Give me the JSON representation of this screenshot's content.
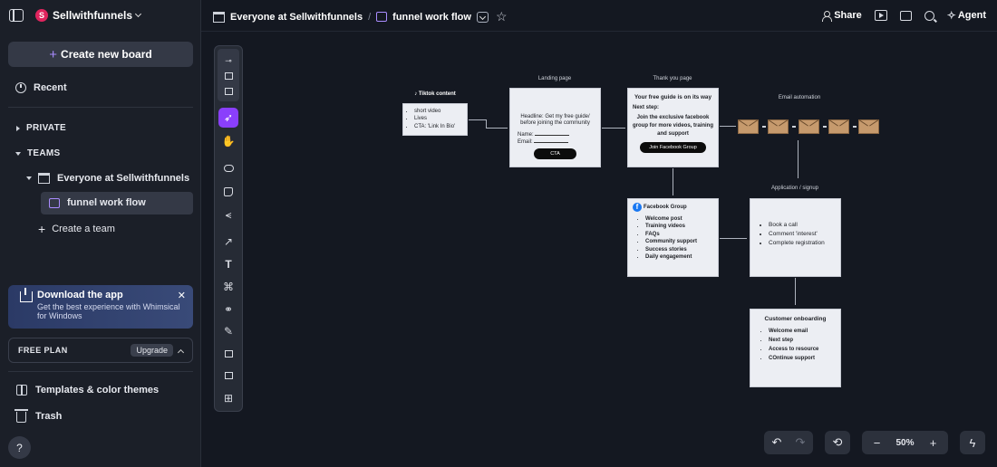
{
  "sidebar": {
    "workspace_initial": "S",
    "workspace_name": "Sellwithfunnels",
    "create_board": "Create new board",
    "recent": "Recent",
    "private": "PRIVATE",
    "teams": "TEAMS",
    "team_name": "Everyone at Sellwithfunnels",
    "active_board": "funnel work flow",
    "create_team": "Create a team",
    "promo": {
      "title": "Download the app",
      "subtitle": "Get the best experience with Whimsical for Windows"
    },
    "plan_label": "FREE PLAN",
    "upgrade": "Upgrade",
    "templates": "Templates & color themes",
    "trash": "Trash",
    "help": "?"
  },
  "header": {
    "breadcrumb_team": "Everyone at Sellwithfunnels",
    "breadcrumb_board": "funnel work flow",
    "share": "Share",
    "agent": "Agent"
  },
  "toolbar": {
    "tools": [
      "diagram-tool",
      "layout-tool",
      "grid-tool",
      "select-tool",
      "hand-tool",
      "shape-tool",
      "sticky-note-tool",
      "mindmap-tool",
      "arrow-tool",
      "text-tool",
      "icon-tool",
      "link-tool",
      "pen-tool",
      "section-tool",
      "frame-tool",
      "add-tool"
    ]
  },
  "canvas": {
    "tiktok": {
      "title": "Tiktok content",
      "items": [
        "short video",
        "Lives",
        "CTA: 'Link In Bio'"
      ]
    },
    "landing": {
      "label": "Landing page",
      "headline": "Headline: Get my free guide/ before joining the community",
      "name_field": "Name:",
      "email_field": "Email:",
      "cta": "CTA"
    },
    "thankyou": {
      "label": "Thank you page",
      "title": "Your free guide is on its way",
      "next": "Next step:",
      "body": "Join the exclusive facebook group for more videos, training and support",
      "button": "Join Facebook Group"
    },
    "email": {
      "label": "Email automation"
    },
    "facebook": {
      "title": "Facebook Group",
      "items": [
        "Welcome post",
        "Training videos",
        "FAQs",
        "Community support",
        "Success stories",
        "Daily engagement"
      ]
    },
    "application": {
      "label": "Application / signup",
      "items": [
        "Book a call",
        "Comment 'interest'",
        "Complete registration"
      ]
    },
    "onboarding": {
      "title": "Customer onboarding",
      "items": [
        "Welcome email",
        "Next step",
        "Access to resource",
        "COntinue support"
      ]
    }
  },
  "controls": {
    "zoom": "50%"
  },
  "colors": {
    "accent": "#8a3ffc",
    "canvas_bg": "#141821",
    "sidebar_bg": "#1b1f28"
  }
}
